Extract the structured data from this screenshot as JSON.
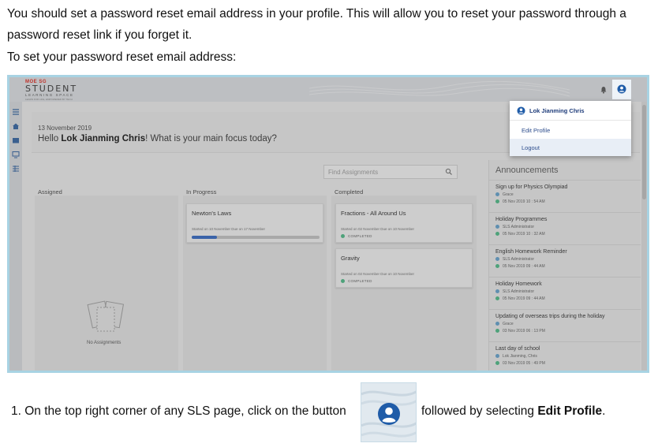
{
  "intro": {
    "line1": "You should set a password reset email address in your profile. This will allow you to reset your password through a",
    "line2": "password reset link if you forget it.",
    "line3": "To set your password reset email address:"
  },
  "app": {
    "logo_brand": "MOE SG",
    "logo_name": "STUDENT",
    "logo_sub": "LEARNING SPACE",
    "logo_tag": "LEARN FOR LIFE, EMPOWERED BY TECH",
    "date": "13 November 2019",
    "greeting_prefix": "Hello ",
    "user_name": "Lok Jianming Chris",
    "greeting_suffix": "! What is your main focus today?",
    "search_placeholder": "Find Assignments",
    "columns": {
      "assigned": "Assigned",
      "in_progress": "In Progress",
      "completed": "Completed"
    },
    "no_assignments": "No Assignments",
    "in_progress_cards": [
      {
        "title": "Newton's Laws",
        "meta": "Started on 10 November Due on 17 November",
        "progress": 0.2
      }
    ],
    "completed_cards": [
      {
        "title": "Fractions - All Around Us",
        "meta": "Started on 02 November Due on 10 November",
        "status": "COMPLETED"
      },
      {
        "title": "Gravity",
        "meta": "Started on 02 November Due on 10 November",
        "status": "COMPLETED"
      }
    ],
    "announcements_title": "Announcements",
    "announcements": [
      {
        "title": "Sign up for Physics Olympiad",
        "author": "Grace",
        "date": "05 Nov 2019 10 : 54 AM"
      },
      {
        "title": "Holiday Programmes",
        "author": "SLS Administrator",
        "date": "05 Nov 2019 10 : 32 AM"
      },
      {
        "title": "English Homework Reminder",
        "author": "SLS Administrator",
        "date": "05 Nov 2019 09 : 44 AM"
      },
      {
        "title": "Holiday Homework",
        "author": "SLS Administrator",
        "date": "05 Nov 2019 09 : 44 AM"
      },
      {
        "title": "Updating of overseas trips during the holiday",
        "author": "Grace",
        "date": "03 Nov 2019 06 : 13 PM"
      },
      {
        "title": "Last day of school",
        "author": "Lok Jianming, Chris",
        "date": "03 Nov 2019 05 : 49 PM"
      }
    ],
    "menu": {
      "user": "Lok Jianming Chris",
      "edit_profile": "Edit Profile",
      "logout": "Logout"
    }
  },
  "step": {
    "text_before": "1. On the top right corner of any SLS page, click on the button",
    "text_after": "followed by selecting ",
    "emphasis": "Edit Profile",
    "end": "."
  },
  "colors": {
    "frame": "#a8d3e3",
    "link_blue": "#2c4c8c",
    "avatar_blue": "#1f5ca8",
    "completed_green": "#4ea27a"
  }
}
